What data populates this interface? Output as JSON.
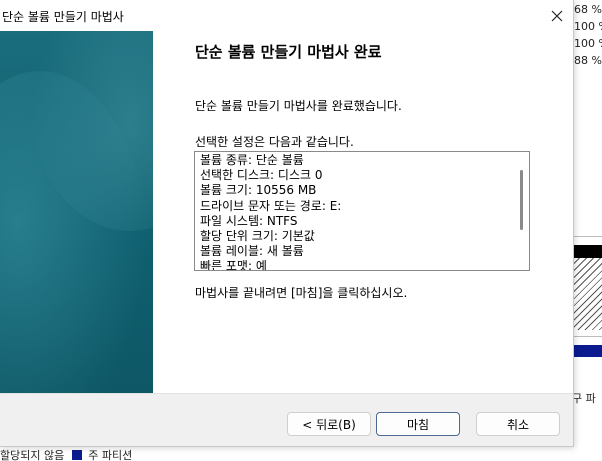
{
  "window": {
    "title": "단순 볼륨 만들기 마법사"
  },
  "page": {
    "heading": "단순 볼륨 만들기 마법사 완료",
    "intro": "단순 볼륨 만들기 마법사를 완료했습니다.",
    "settings_label": "선택한 설정은 다음과 같습니다.",
    "settings": [
      "볼륨 종류: 단순 볼륨",
      "선택한 디스크: 디스크 0",
      "볼륨 크기: 10556 MB",
      "드라이브 문자 또는 경로: E:",
      "파일 시스템: NTFS",
      "할당 단위 크기: 기본값",
      "볼륨 레이블: 새 볼륨",
      "빠른 포맷: 예"
    ],
    "outro": "마법사를 끝내려면 [마침]을 클릭하십시오."
  },
  "buttons": {
    "back": "< 뒤로(B)",
    "finish": "마침",
    "cancel": "취소"
  },
  "background": {
    "percents": [
      "68 %",
      "100 %",
      "100 %",
      "88 %"
    ],
    "side_text": "구 파",
    "legend_prefix": "할당되지 않음",
    "legend_label": "주 파티션"
  },
  "colors": {
    "panel": "#0f5f6f",
    "primary_partition": "#0b1a8e"
  },
  "icons": {
    "close": "close-icon"
  }
}
